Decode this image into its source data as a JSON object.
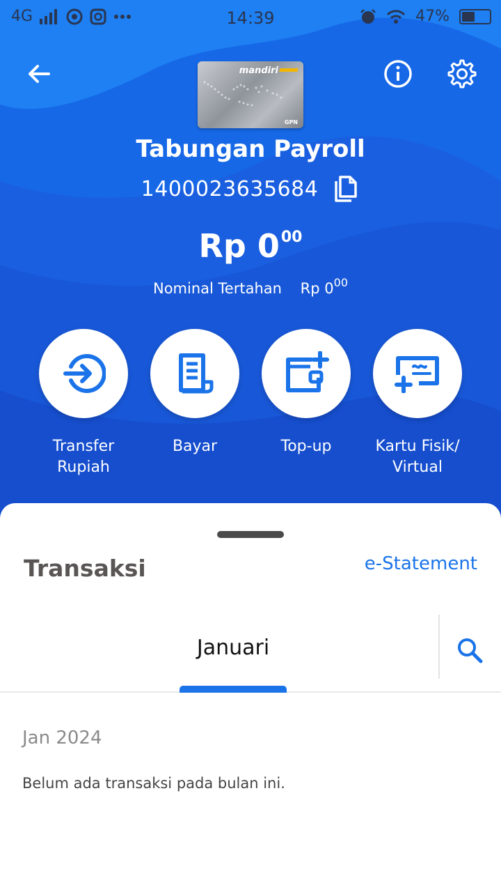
{
  "status_bar": {
    "network": "4G",
    "time": "14:39",
    "battery": "47%",
    "battery_level": 0.47
  },
  "card": {
    "brand": "mandiri",
    "network_logo": "GPN"
  },
  "account": {
    "name": "Tabungan Payroll",
    "number": "1400023635684"
  },
  "balance": {
    "currency": "Rp",
    "amount": "0",
    "decimals": "00"
  },
  "held": {
    "label": "Nominal Tertahan",
    "currency": "Rp",
    "amount": "0",
    "decimals": "00"
  },
  "actions": [
    {
      "line1": "Transfer",
      "line2": "Rupiah",
      "icon": "transfer-icon"
    },
    {
      "line1": "Bayar",
      "line2": "",
      "icon": "bill-icon"
    },
    {
      "line1": "Top-up",
      "line2": "",
      "icon": "wallet-add-icon"
    },
    {
      "line1": "Kartu Fisik/",
      "line2": "Virtual",
      "icon": "card-add-icon"
    }
  ],
  "transactions": {
    "title": "Transaksi",
    "estatement_label": "e-Statement",
    "selected_month": "Januari",
    "month_header": "Jan 2024",
    "empty_message": "Belum ada transaksi pada bulan ini."
  },
  "colors": {
    "brand_blue": "#1a5fe0",
    "accent": "#1a73e8"
  }
}
